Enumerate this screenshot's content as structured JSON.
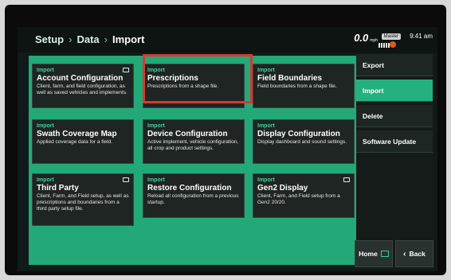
{
  "breadcrumb": {
    "items": [
      "Setup",
      "Data",
      "Import"
    ],
    "separator": "›"
  },
  "status": {
    "speed": "0.0",
    "speed_unit": "mph",
    "master": "Master",
    "time": "9:41 am"
  },
  "tiles": [
    {
      "kicker": "Import",
      "title": "Account Configuration",
      "description": "Client, farm, and field configuration, as well as saved vehicles and implements."
    },
    {
      "kicker": "Import",
      "title": "Prescriptions",
      "description": "Prescriptions from a shape file."
    },
    {
      "kicker": "Import",
      "title": "Field Boundaries",
      "description": "Field boundaries from a shape file."
    },
    {
      "kicker": "Import",
      "title": "Swath Coverage Map",
      "description": "Applied coverage data for a field."
    },
    {
      "kicker": "Import",
      "title": "Device Configuration",
      "description": "Active implement, vehicle configuration, all crop and product settings."
    },
    {
      "kicker": "Import",
      "title": "Display Configuration",
      "description": "Display dashboard and sound settings."
    },
    {
      "kicker": "Import",
      "title": "Third Party",
      "description": "Client, Farm, and Field setup, as well as prescriptions and boundaries from a third party setup file."
    },
    {
      "kicker": "Import",
      "title": "Restore Configuration",
      "description": "Reload all configuration from a previous startup."
    },
    {
      "kicker": "Import",
      "title": "Gen2 Display",
      "description": "Client, Farm, and Field setup from a Gen2 20/20."
    }
  ],
  "sidebar": {
    "items": [
      {
        "label": "Export"
      },
      {
        "label": "Import"
      },
      {
        "label": "Delete"
      },
      {
        "label": "Software Update"
      }
    ],
    "active": "Import"
  },
  "bottom": {
    "home": "Home",
    "back": "Back"
  },
  "colors": {
    "panel": "#23a978",
    "tile": "#1f2523",
    "accent": "#3fd39a",
    "highlight": "#d63a2f"
  }
}
